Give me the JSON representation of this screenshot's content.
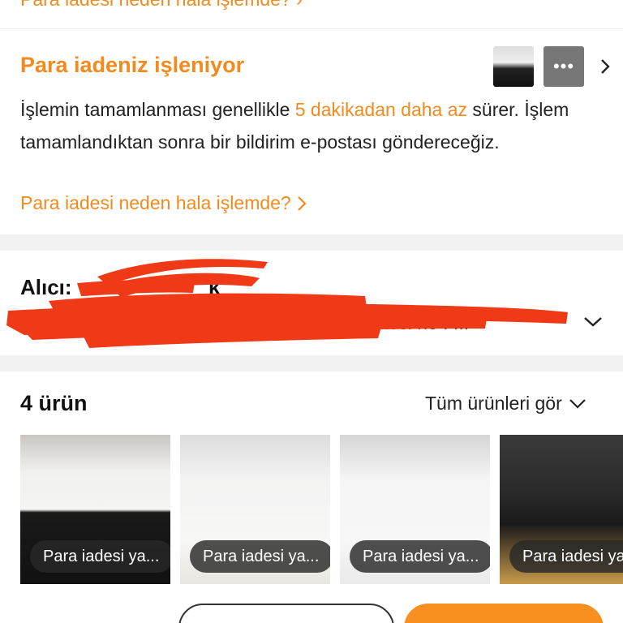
{
  "top_link": {
    "label": "Para iadesi neden hala işlemde?"
  },
  "refund_status": {
    "title": "Para iadeniz işleniyor",
    "text_before": "İşlemin tamamlanması genellikle ",
    "text_highlight": "5 dakikadan daha az",
    "text_after": " sürer. İşlem tamamlandıktan sonra bir bildirim e-postası göndereceğiz.",
    "why_link": "Para iadesi neden hala işlemde?",
    "thumb_more": "•••"
  },
  "recipient": {
    "label": "Alıcı:",
    "name_fragment": "k",
    "address_fragment": "...sesi nyh metro ... yöreçkesi no : ..."
  },
  "products": {
    "count_label": "4 ürün",
    "see_all_label": "Tüm ürünleri gör",
    "items": [
      {
        "badge": "Para iadesi ya..."
      },
      {
        "badge": "Para iadesi ya..."
      },
      {
        "badge": "Para iadesi ya..."
      },
      {
        "badge": "Para iadesi ya..."
      }
    ]
  },
  "colors": {
    "accent": "#f28a1e",
    "redaction": "#f03a17"
  }
}
